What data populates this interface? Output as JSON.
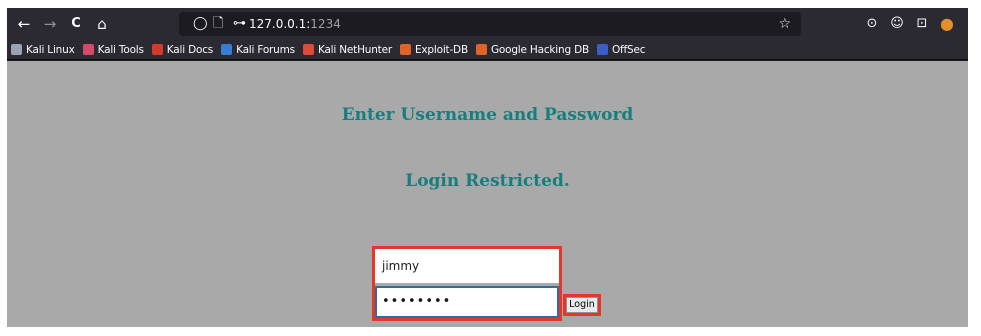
{
  "toolbar": {
    "back_icon": "←",
    "forward_icon": "→",
    "reload_icon": "C",
    "home_icon": "⌂",
    "shield_icon": "◯",
    "page_icon": "🗋",
    "key_icon": "⊶",
    "url_host": "127.0.0.1:",
    "url_port": "1234",
    "bookmark_star_icon": "☆",
    "pocket_icon": "⊙",
    "account_icon": "☺",
    "extensions_icon": "⊡",
    "profile_icon": "⬤"
  },
  "bookmarks": [
    {
      "label": "Kali Linux",
      "color": "#9aa3b4"
    },
    {
      "label": "Kali Tools",
      "color": "#d34a6a"
    },
    {
      "label": "Kali Docs",
      "color": "#d33a2b"
    },
    {
      "label": "Kali Forums",
      "color": "#3a7bd5"
    },
    {
      "label": "Kali NetHunter",
      "color": "#e04838"
    },
    {
      "label": "Exploit-DB",
      "color": "#e0632a"
    },
    {
      "label": "Google Hacking DB",
      "color": "#e0632a"
    },
    {
      "label": "OffSec",
      "color": "#3c5ec9"
    }
  ],
  "page": {
    "heading": "Enter Username and Password",
    "restricted": "Login Restricted.",
    "username_value": "jimmy",
    "password_value": "••••••••",
    "login_label": "Login"
  },
  "colors": {
    "page_bg": "#aaa9aa",
    "heading": "#147f7d",
    "highlight": "#e43726"
  }
}
